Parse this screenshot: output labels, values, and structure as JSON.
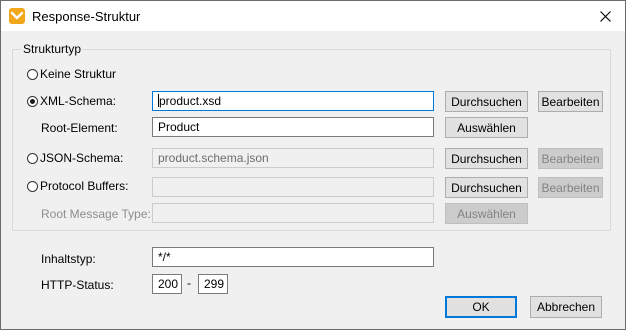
{
  "window": {
    "title": "Response-Struktur"
  },
  "group": {
    "label": "Strukturtyp"
  },
  "options": {
    "none": {
      "label": "Keine Struktur"
    },
    "xml": {
      "label": "XML-Schema:",
      "value": "product.xsd",
      "browse": "Durchsuchen",
      "edit": "Bearbeiten",
      "root_label": "Root-Element:",
      "root_value": "Product",
      "root_select": "Auswählen"
    },
    "json": {
      "label": "JSON-Schema:",
      "value": "product.schema.json",
      "browse": "Durchsuchen",
      "edit": "Bearbeiten"
    },
    "protobuf": {
      "label": "Protocol Buffers:",
      "value": "",
      "browse": "Durchsuchen",
      "edit": "Bearbeiten",
      "root_label": "Root Message Type:",
      "root_value": "",
      "root_select": "Auswählen"
    }
  },
  "content_type": {
    "label": "Inhaltstyp:",
    "value": "*/*"
  },
  "http_status": {
    "label": "HTTP-Status:",
    "from": "200",
    "separator": "-",
    "to": "299"
  },
  "buttons": {
    "ok": "OK",
    "cancel": "Abbrechen"
  }
}
